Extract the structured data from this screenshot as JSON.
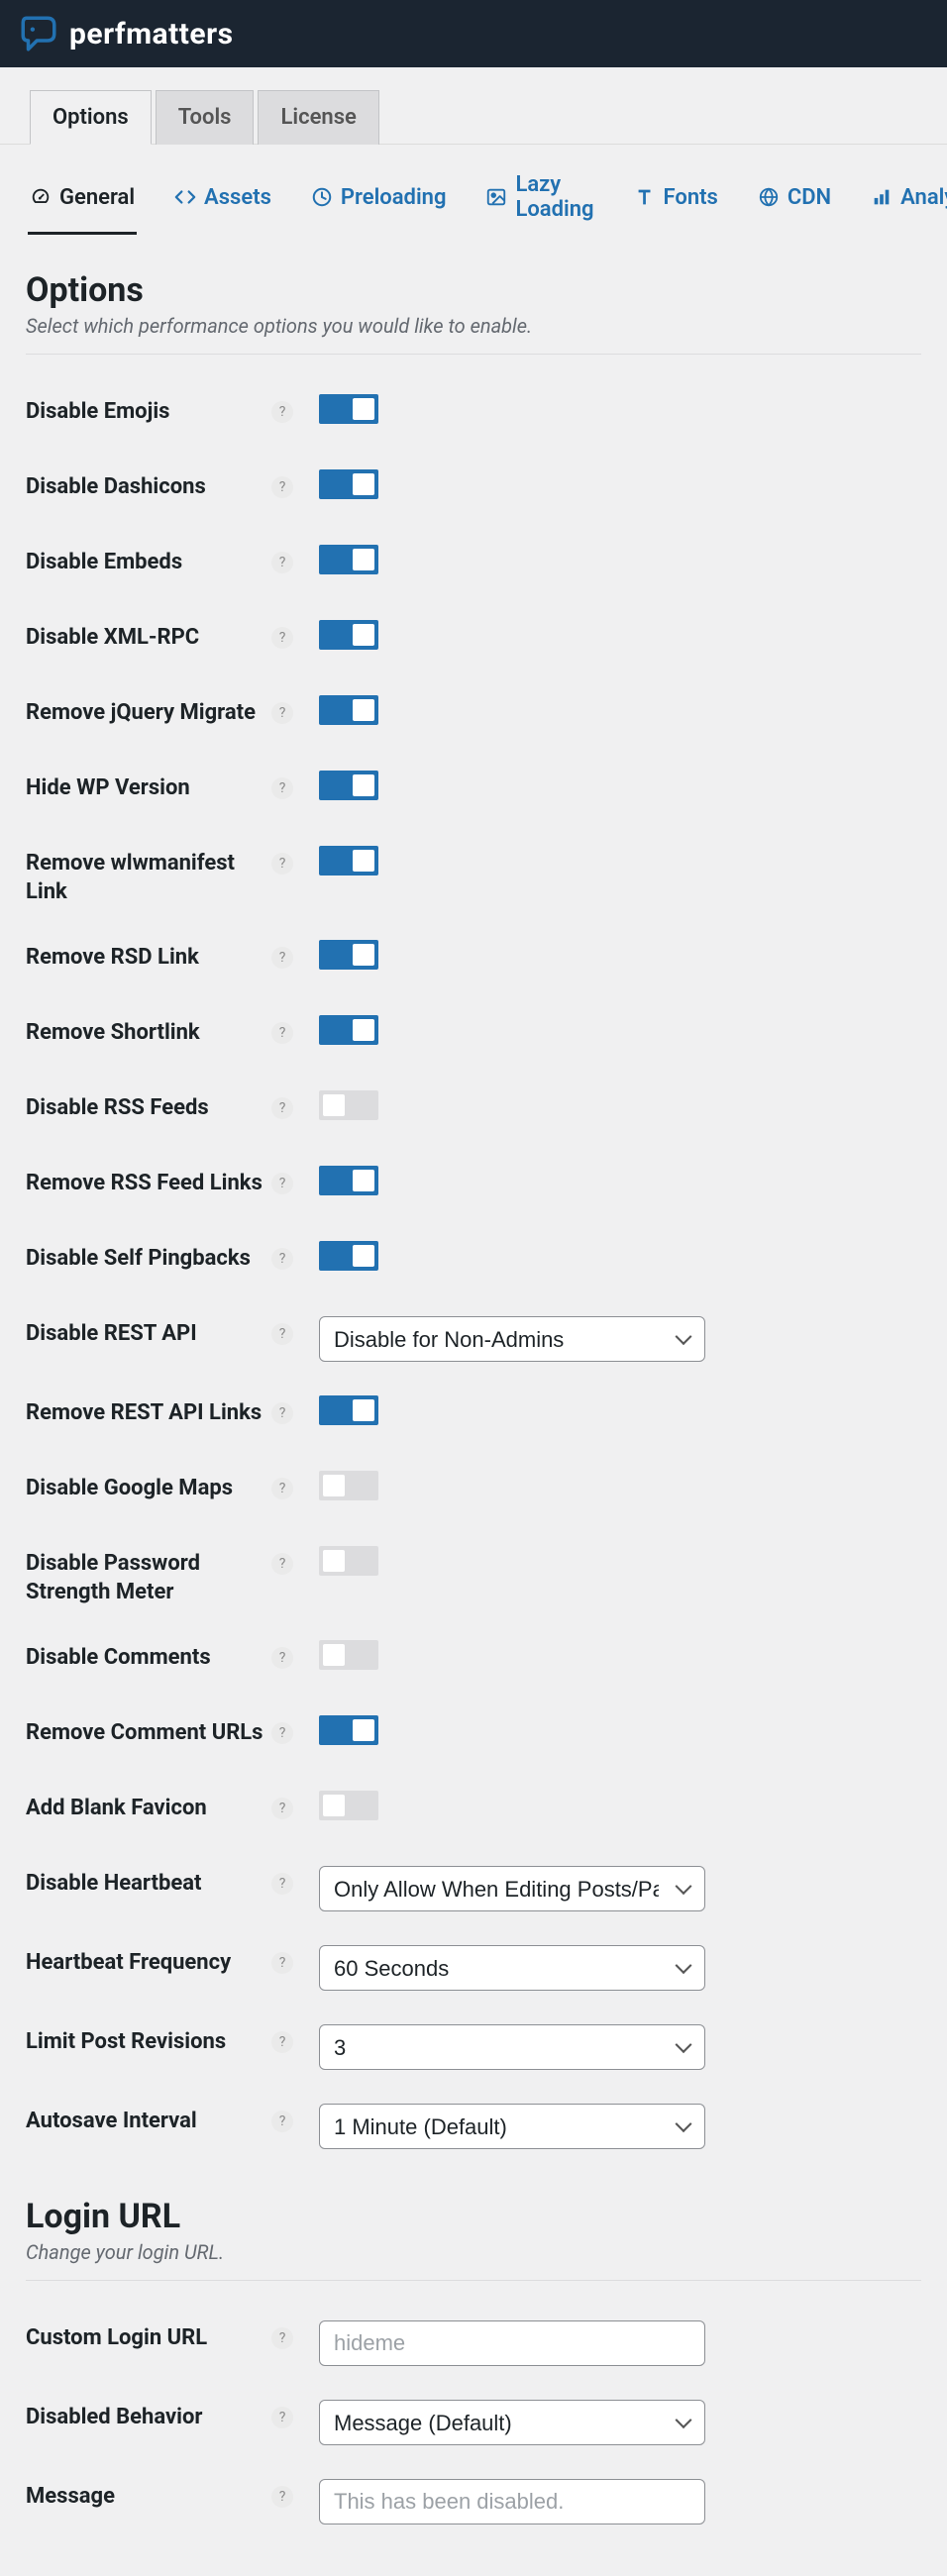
{
  "header": {
    "brand": "perfmatters"
  },
  "main_tabs": [
    {
      "id": "options",
      "label": "Options",
      "active": true
    },
    {
      "id": "tools",
      "label": "Tools",
      "active": false
    },
    {
      "id": "license",
      "label": "License",
      "active": false
    }
  ],
  "sub_tabs": [
    {
      "id": "general",
      "label": "General",
      "icon": "dashboard-icon",
      "active": true
    },
    {
      "id": "assets",
      "label": "Assets",
      "icon": "code-icon",
      "active": false
    },
    {
      "id": "preloading",
      "label": "Preloading",
      "icon": "clock-icon",
      "active": false
    },
    {
      "id": "lazy",
      "label": "Lazy Loading",
      "icon": "image-icon",
      "active": false
    },
    {
      "id": "fonts",
      "label": "Fonts",
      "icon": "font-icon",
      "active": false
    },
    {
      "id": "cdn",
      "label": "CDN",
      "icon": "globe-icon",
      "active": false
    },
    {
      "id": "analytics",
      "label": "Analytics",
      "icon": "bar-chart-icon",
      "active": false
    }
  ],
  "sections": {
    "options": {
      "title": "Options",
      "subtitle": "Select which performance options you would like to enable.",
      "rows": [
        {
          "key": "disable_emojis",
          "label": "Disable Emojis",
          "type": "toggle",
          "value": true
        },
        {
          "key": "disable_dashicons",
          "label": "Disable Dashicons",
          "type": "toggle",
          "value": true
        },
        {
          "key": "disable_embeds",
          "label": "Disable Embeds",
          "type": "toggle",
          "value": true
        },
        {
          "key": "disable_xmlrpc",
          "label": "Disable XML-RPC",
          "type": "toggle",
          "value": true
        },
        {
          "key": "remove_jquery_migrate",
          "label": "Remove jQuery Migrate",
          "type": "toggle",
          "value": true
        },
        {
          "key": "hide_wp_version",
          "label": "Hide WP Version",
          "type": "toggle",
          "value": true
        },
        {
          "key": "remove_wlwmanifest",
          "label": "Remove wlwmanifest Link",
          "type": "toggle",
          "value": true
        },
        {
          "key": "remove_rsd",
          "label": "Remove RSD Link",
          "type": "toggle",
          "value": true
        },
        {
          "key": "remove_shortlink",
          "label": "Remove Shortlink",
          "type": "toggle",
          "value": true
        },
        {
          "key": "disable_rss",
          "label": "Disable RSS Feeds",
          "type": "toggle",
          "value": false
        },
        {
          "key": "remove_rss_links",
          "label": "Remove RSS Feed Links",
          "type": "toggle",
          "value": true
        },
        {
          "key": "disable_self_pingbacks",
          "label": "Disable Self Pingbacks",
          "type": "toggle",
          "value": true
        },
        {
          "key": "disable_rest_api",
          "label": "Disable REST API",
          "type": "select",
          "value": "Disable for Non-Admins"
        },
        {
          "key": "remove_rest_links",
          "label": "Remove REST API Links",
          "type": "toggle",
          "value": true
        },
        {
          "key": "disable_google_maps",
          "label": "Disable Google Maps",
          "type": "toggle",
          "value": false
        },
        {
          "key": "disable_pw_strength",
          "label": "Disable Password Strength Meter",
          "type": "toggle",
          "value": false
        },
        {
          "key": "disable_comments",
          "label": "Disable Comments",
          "type": "toggle",
          "value": false
        },
        {
          "key": "remove_comment_urls",
          "label": "Remove Comment URLs",
          "type": "toggle",
          "value": true
        },
        {
          "key": "add_blank_favicon",
          "label": "Add Blank Favicon",
          "type": "toggle",
          "value": false
        },
        {
          "key": "disable_heartbeat",
          "label": "Disable Heartbeat",
          "type": "select",
          "value": "Only Allow When Editing Posts/Pages"
        },
        {
          "key": "heartbeat_frequency",
          "label": "Heartbeat Frequency",
          "type": "select",
          "value": "60 Seconds"
        },
        {
          "key": "limit_post_revisions",
          "label": "Limit Post Revisions",
          "type": "select",
          "value": "3"
        },
        {
          "key": "autosave_interval",
          "label": "Autosave Interval",
          "type": "select",
          "value": "1 Minute (Default)"
        }
      ]
    },
    "login_url": {
      "title": "Login URL",
      "subtitle": "Change your login URL.",
      "rows": [
        {
          "key": "custom_login_url",
          "label": "Custom Login URL",
          "type": "text",
          "value": "",
          "placeholder": "hideme"
        },
        {
          "key": "disabled_behavior",
          "label": "Disabled Behavior",
          "type": "select",
          "value": "Message (Default)"
        },
        {
          "key": "message",
          "label": "Message",
          "type": "text",
          "value": "",
          "placeholder": "This has been disabled."
        }
      ]
    }
  },
  "help_char": "?"
}
